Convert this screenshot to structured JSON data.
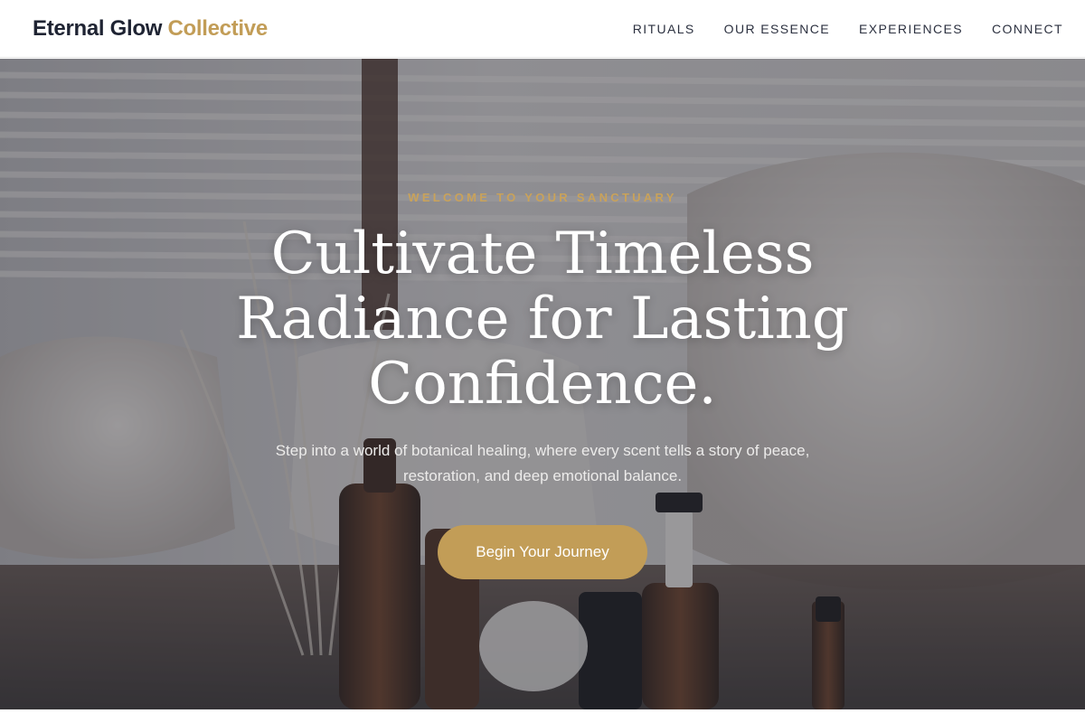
{
  "brand": {
    "name_primary": "Eternal Glow",
    "name_accent": "Collective"
  },
  "nav": {
    "items": [
      {
        "label": "RITUALS"
      },
      {
        "label": "OUR ESSENCE"
      },
      {
        "label": "EXPERIENCES"
      },
      {
        "label": "CONNECT"
      }
    ]
  },
  "hero": {
    "eyebrow": "WELCOME TO YOUR SANCTUARY",
    "headline": "Cultivate Timeless Radiance for Lasting Confidence.",
    "subtext": "Step into a world of botanical healing, where every scent tells a story of peace, restoration, and deep emotional balance.",
    "cta_label": "Begin Your Journey"
  },
  "colors": {
    "accent_gold": "#c29d57",
    "eyebrow_gold": "#c9a25a",
    "text_dark": "#1f2433",
    "nav_text": "#2c3140"
  }
}
